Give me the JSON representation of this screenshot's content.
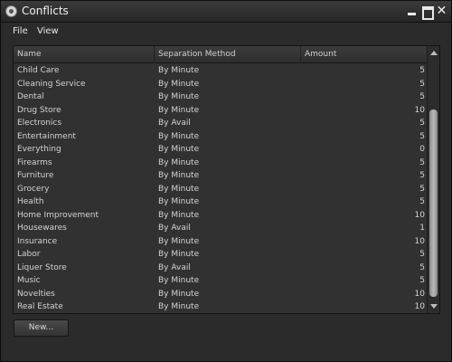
{
  "window": {
    "title": "Conflicts"
  },
  "menu": {
    "file": "File",
    "view": "View"
  },
  "table": {
    "headers": {
      "name": "Name",
      "method": "Separation Method",
      "amount": "Amount"
    },
    "rows": [
      {
        "name": "Child Care",
        "method": "By Minute",
        "amount": "5"
      },
      {
        "name": "Cleaning Service",
        "method": "By Minute",
        "amount": "5"
      },
      {
        "name": "Dental",
        "method": "By Minute",
        "amount": "5"
      },
      {
        "name": "Drug Store",
        "method": "By Minute",
        "amount": "10"
      },
      {
        "name": "Electronics",
        "method": "By Avail",
        "amount": "5"
      },
      {
        "name": "Entertainment",
        "method": "By Minute",
        "amount": "5"
      },
      {
        "name": "Everything",
        "method": "By Minute",
        "amount": "0"
      },
      {
        "name": "Firearms",
        "method": "By Minute",
        "amount": "5"
      },
      {
        "name": "Furniture",
        "method": "By Minute",
        "amount": "5"
      },
      {
        "name": "Grocery",
        "method": "By Minute",
        "amount": "5"
      },
      {
        "name": "Health",
        "method": "By Minute",
        "amount": "5"
      },
      {
        "name": "Home Improvement",
        "method": "By Minute",
        "amount": "10"
      },
      {
        "name": "Housewares",
        "method": "By Avail",
        "amount": "1"
      },
      {
        "name": "Insurance",
        "method": "By Minute",
        "amount": "10"
      },
      {
        "name": "Labor",
        "method": "By Minute",
        "amount": "5"
      },
      {
        "name": "Liquer Store",
        "method": "By Avail",
        "amount": "5"
      },
      {
        "name": "Music",
        "method": "By Minute",
        "amount": "5"
      },
      {
        "name": "Novelties",
        "method": "By Minute",
        "amount": "10"
      },
      {
        "name": "Real Estate",
        "method": "By Minute",
        "amount": "10"
      }
    ]
  },
  "buttons": {
    "new": "New..."
  },
  "icons": {
    "app": "app-icon",
    "minimize": "minimize-icon",
    "maximize": "maximize-icon",
    "close": "close-icon",
    "scroll_up": "chevron-up-icon",
    "scroll_down": "chevron-down-icon"
  },
  "colors": {
    "background": "#2b2b2b",
    "table": "#313131",
    "text": "#d4d4d4",
    "thumb": "#a8a8a8"
  }
}
